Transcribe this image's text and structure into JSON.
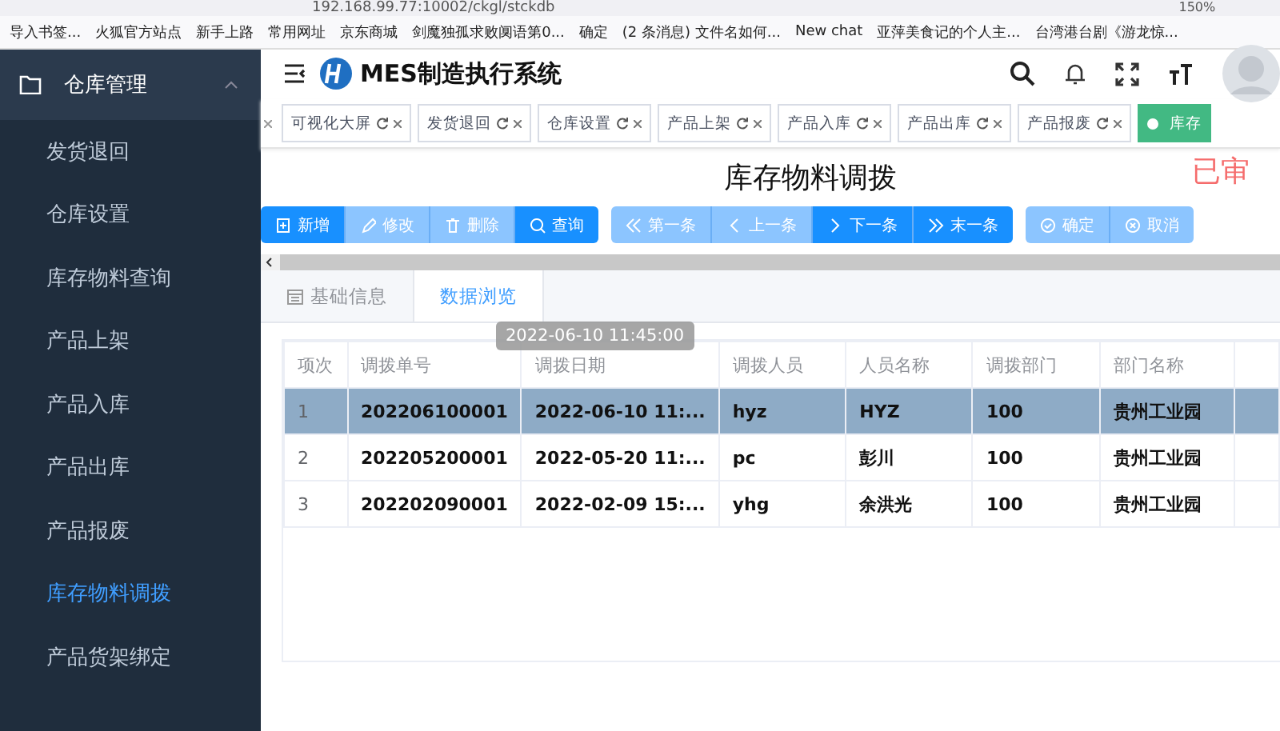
{
  "browser": {
    "address": "192.168.99.77:10002/ckgl/stckdb",
    "zoom": "150%",
    "bookmarks": [
      "导入书签...",
      "火狐官方站点",
      "新手上路",
      "常用网址",
      "京东商城",
      "剑魔独孤求败阒语第0...",
      "确定",
      "(2 条消息) 文件名如何...",
      "New chat",
      "亚萍美食记的个人主...",
      "台湾港台剧《游龙惊..."
    ]
  },
  "sidebar": {
    "group": {
      "label": "仓库管理",
      "expanded": true
    },
    "items": [
      {
        "label": "发货退回",
        "selected": false
      },
      {
        "label": "仓库设置",
        "selected": false
      },
      {
        "label": "库存物料查询",
        "selected": false
      },
      {
        "label": "产品上架",
        "selected": false
      },
      {
        "label": "产品入库",
        "selected": false
      },
      {
        "label": "产品出库",
        "selected": false
      },
      {
        "label": "产品报废",
        "selected": false
      },
      {
        "label": "库存物料调拨",
        "selected": true
      },
      {
        "label": "产品货架绑定",
        "selected": false
      }
    ]
  },
  "header": {
    "title": "MES制造执行系统"
  },
  "tags": [
    {
      "label": "可视化大屏",
      "selected": false
    },
    {
      "label": "发货退回",
      "selected": false
    },
    {
      "label": "仓库设置",
      "selected": false
    },
    {
      "label": "产品上架",
      "selected": false
    },
    {
      "label": "产品入库",
      "selected": false
    },
    {
      "label": "产品出库",
      "selected": false
    },
    {
      "label": "产品报废",
      "selected": false
    },
    {
      "label": "库存",
      "selected": true
    }
  ],
  "page": {
    "title": "库存物料调拨",
    "stamp": "已审"
  },
  "toolbar": [
    [
      {
        "label": "新增",
        "disabled": false
      },
      {
        "label": "修改",
        "disabled": true
      },
      {
        "label": "删除",
        "disabled": true
      },
      {
        "label": "查询",
        "disabled": false
      }
    ],
    [
      {
        "label": "第一条",
        "disabled": true
      },
      {
        "label": "上一条",
        "disabled": true
      },
      {
        "label": "下一条",
        "disabled": false
      },
      {
        "label": "末一条",
        "disabled": false
      }
    ],
    [
      {
        "label": "确定",
        "disabled": true
      },
      {
        "label": "取消",
        "disabled": true
      }
    ]
  ],
  "tabs": [
    {
      "label": "基础信息",
      "selected": false
    },
    {
      "label": "数据浏览",
      "selected": true
    }
  ],
  "table": {
    "columns": [
      "项次",
      "调拨单号",
      "调拨日期",
      "调拨人员",
      "人员名称",
      "调拨部门",
      "部门名称"
    ],
    "tooltip": "2022-06-10 11:45:00",
    "rows": [
      {
        "selected": true,
        "cells": [
          "1",
          "202206100001",
          "2022-06-10 11:...",
          "hyz",
          "HYZ",
          "100",
          "贵州工业园"
        ]
      },
      {
        "selected": false,
        "cells": [
          "2",
          "202205200001",
          "2022-05-20 11:...",
          "pc",
          "彭川",
          "100",
          "贵州工业园"
        ]
      },
      {
        "selected": false,
        "cells": [
          "3",
          "202202090001",
          "2022-02-09 15:...",
          "yhg",
          "余洪光",
          "100",
          "贵州工业园"
        ]
      }
    ]
  }
}
